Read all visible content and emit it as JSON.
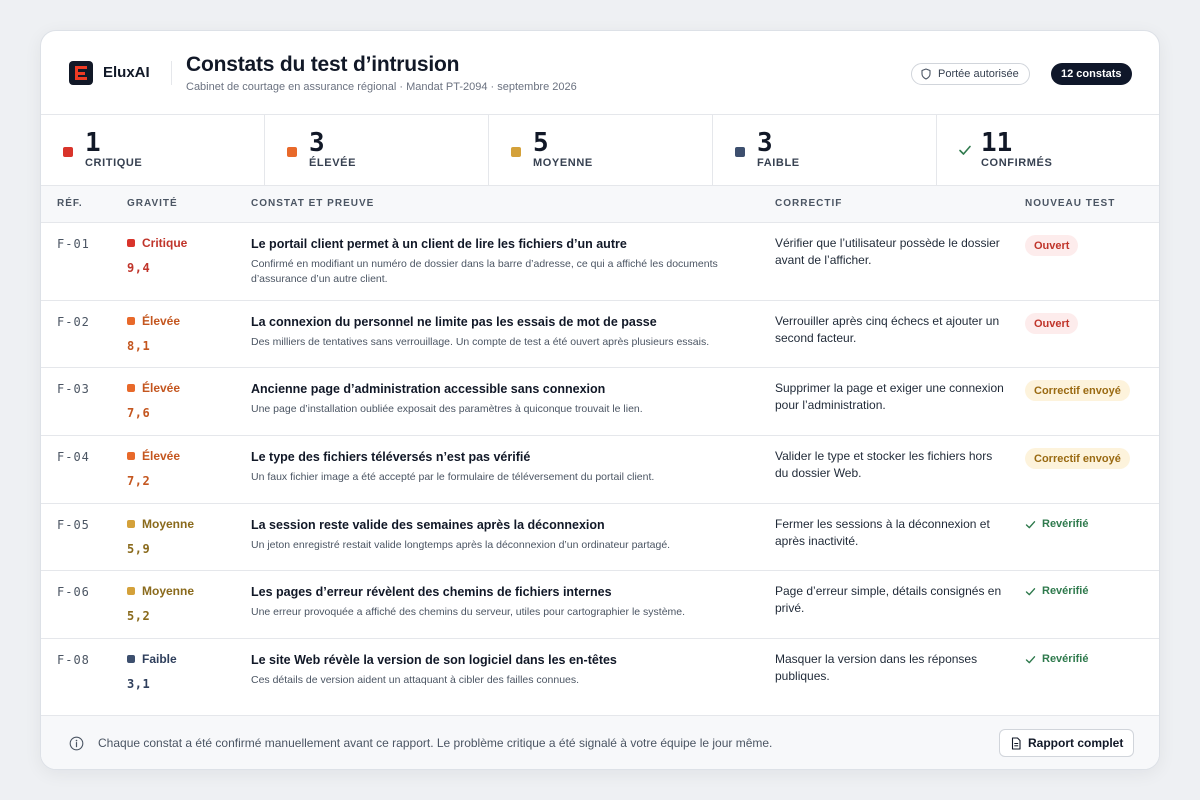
{
  "brand": {
    "name": "EluxAI"
  },
  "header": {
    "title": "Constats du test d’intrusion",
    "subtitle": "Cabinet de courtage en assurance régional · Mandat PT-2094 · septembre 2026",
    "scope_label": "Portée autorisée",
    "count_label": "12 constats"
  },
  "stats": [
    {
      "value": "1",
      "label": "CRITIQUE",
      "color": "#d9342b"
    },
    {
      "value": "3",
      "label": "ÉLEVÉE",
      "color": "#e8692a"
    },
    {
      "value": "5",
      "label": "MOYENNE",
      "color": "#d4a13a"
    },
    {
      "value": "3",
      "label": "FAIBLE",
      "color": "#3d4f6e"
    },
    {
      "value": "11",
      "label": "CONFIRMÉS",
      "icon": "check-icon"
    }
  ],
  "table": {
    "headers": {
      "ref": "RÉF.",
      "severity": "GRAVITÉ",
      "finding": "CONSTAT ET PREUVE",
      "fix": "CORRECTIF",
      "retest": "NOUVEAU TEST"
    },
    "rows": [
      {
        "ref": "F-01",
        "severity": "Critique",
        "sev_color": "#d9342b",
        "sev_text": "#c0352b",
        "score": "9,4",
        "title": "Le portail client permet à un client de lire les fichiers d’un autre",
        "desc": "Confirmé en modifiant un numéro de dossier dans la barre d’adresse, ce qui a affiché les documents d’assurance d’un autre client.",
        "fix": "Vérifier que l’utilisateur possède le dossier avant de l’afficher.",
        "status": "Ouvert",
        "status_type": "open"
      },
      {
        "ref": "F-02",
        "severity": "Élevée",
        "sev_color": "#e8692a",
        "sev_text": "#c4561f",
        "score": "8,1",
        "title": "La connexion du personnel ne limite pas les essais de mot de passe",
        "desc": "Des milliers de tentatives sans verrouillage. Un compte de test a été ouvert après plusieurs essais.",
        "fix": "Verrouiller après cinq échecs et ajouter un second facteur.",
        "status": "Ouvert",
        "status_type": "open"
      },
      {
        "ref": "F-03",
        "severity": "Élevée",
        "sev_color": "#e8692a",
        "sev_text": "#c4561f",
        "score": "7,6",
        "title": "Ancienne page d’administration accessible sans connexion",
        "desc": "Une page d’installation oubliée exposait des paramètres à quiconque trouvait le lien.",
        "fix": "Supprimer la page et exiger une connexion pour l’administration.",
        "status": "Correctif envoyé",
        "status_type": "sent"
      },
      {
        "ref": "F-04",
        "severity": "Élevée",
        "sev_color": "#e8692a",
        "sev_text": "#c4561f",
        "score": "7,2",
        "title": "Le type des fichiers téléversés n’est pas vérifié",
        "desc": "Un faux fichier image a été accepté par le formulaire de téléversement du portail client.",
        "fix": "Valider le type et stocker les fichiers hors du dossier Web.",
        "status": "Correctif envoyé",
        "status_type": "sent"
      },
      {
        "ref": "F-05",
        "severity": "Moyenne",
        "sev_color": "#d4a13a",
        "sev_text": "#8a6a1c",
        "score": "5,9",
        "title": "La session reste valide des semaines après la déconnexion",
        "desc": "Un jeton enregistré restait valide longtemps après la déconnexion d’un ordinateur partagé.",
        "fix": "Fermer les sessions à la déconnexion et après inactivité.",
        "status": "Revérifié",
        "status_type": "verified"
      },
      {
        "ref": "F-06",
        "severity": "Moyenne",
        "sev_color": "#d4a13a",
        "sev_text": "#8a6a1c",
        "score": "5,2",
        "title": "Les pages d’erreur révèlent des chemins de fichiers internes",
        "desc": "Une erreur provoquée a affiché des chemins du serveur, utiles pour cartographier le système.",
        "fix": "Page d’erreur simple, détails consignés en privé.",
        "status": "Revérifié",
        "status_type": "verified"
      },
      {
        "ref": "F-08",
        "severity": "Faible",
        "sev_color": "#3d4f6e",
        "sev_text": "#2f3f5c",
        "score": "3,1",
        "title": "Le site Web révèle la version de son logiciel dans les en-têtes",
        "desc": "Ces détails de version aident un attaquant à cibler des failles connues.",
        "fix": "Masquer la version dans les réponses publiques.",
        "status": "Revérifié",
        "status_type": "verified"
      }
    ]
  },
  "footer": {
    "note": "Chaque constat a été confirmé manuellement avant ce rapport. Le problème critique a été signalé à votre équipe le jour même.",
    "report_button": "Rapport complet"
  }
}
